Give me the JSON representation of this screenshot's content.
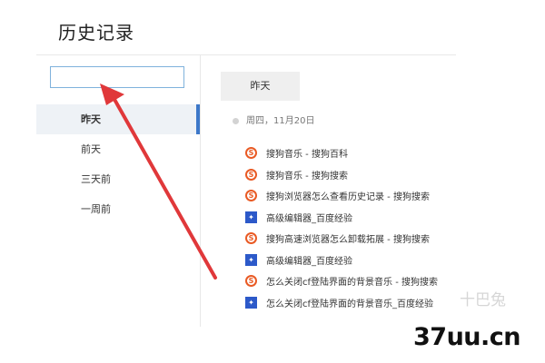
{
  "page": {
    "title": "历史记录"
  },
  "search": {
    "value": "",
    "placeholder": ""
  },
  "sidebar": {
    "items": [
      {
        "label": "昨天",
        "active": true
      },
      {
        "label": "前天"
      },
      {
        "label": "三天前"
      },
      {
        "label": "一周前"
      }
    ]
  },
  "main": {
    "day_tab": "昨天",
    "date_label": "周四，11月20日",
    "history": [
      {
        "icon": "sogou-icon",
        "title": "搜狗音乐 - 搜狗百科"
      },
      {
        "icon": "sogou-icon",
        "title": "搜狗音乐 - 搜狗搜索"
      },
      {
        "icon": "sogou-icon",
        "title": "搜狗浏览器怎么查看历史记录 - 搜狗搜索"
      },
      {
        "icon": "baidu-icon",
        "title": "高级编辑器_百度经验"
      },
      {
        "icon": "sogou-icon",
        "title": "搜狗高速浏览器怎么卸载拓展 - 搜狗搜索"
      },
      {
        "icon": "baidu-icon",
        "title": "高级编辑器_百度经验"
      },
      {
        "icon": "sogou-icon",
        "title": "怎么关闭cf登陆界面的背景音乐 - 搜狗搜索"
      },
      {
        "icon": "baidu-icon",
        "title": "怎么关闭cf登陆界面的背景音乐_百度经验"
      }
    ]
  },
  "annotation": {
    "arrow_color": "#e0383a"
  },
  "watermark": {
    "text": "37uu.cn",
    "faint_text": "十巴兔"
  }
}
